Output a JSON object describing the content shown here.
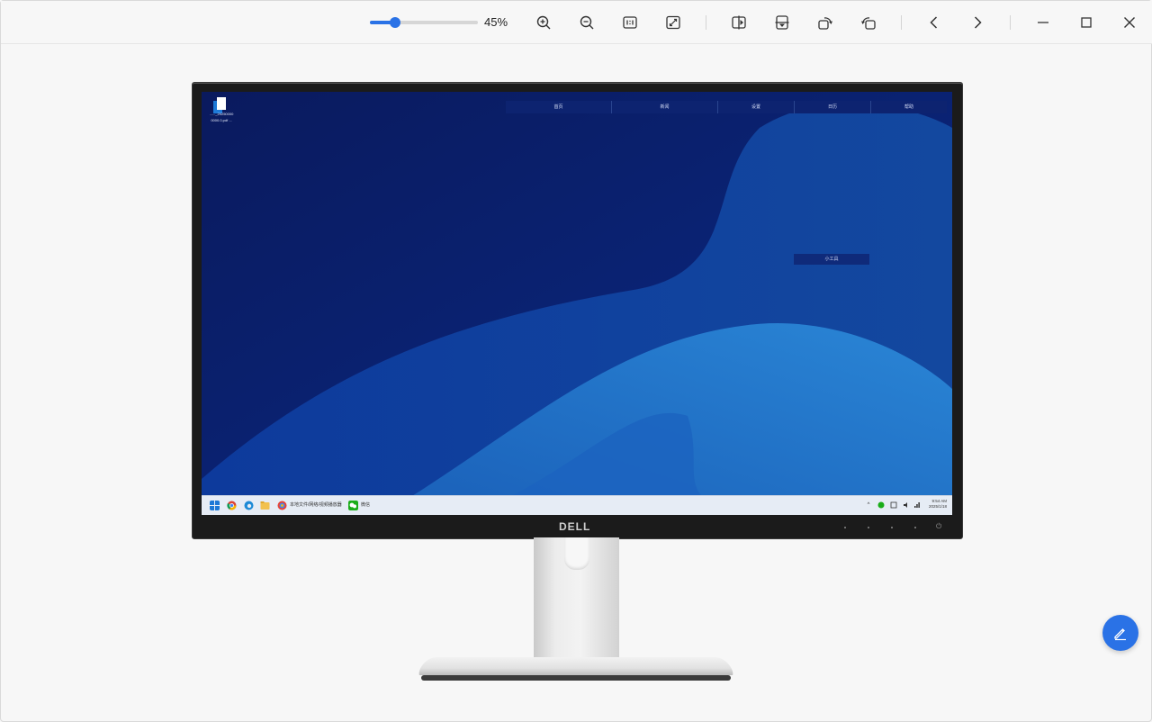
{
  "toolbar": {
    "zoom_percent": 45,
    "zoom_label": "45%",
    "zoom_slider_fraction": 0.23,
    "accent": "#2a72e6",
    "buttons": [
      {
        "name": "zoom-in-icon"
      },
      {
        "name": "zoom-out-icon"
      },
      {
        "name": "actual-size-icon"
      },
      {
        "name": "fit-window-icon"
      },
      {
        "name": "flip-horizontal-icon"
      },
      {
        "name": "flip-vertical-icon"
      },
      {
        "name": "rotate-right-icon"
      },
      {
        "name": "rotate-left-icon"
      },
      {
        "name": "previous-icon"
      },
      {
        "name": "next-icon"
      },
      {
        "name": "minimize-icon"
      },
      {
        "name": "maximize-icon"
      },
      {
        "name": "close-icon"
      }
    ]
  },
  "image": {
    "monitor_brand": "DELL",
    "desktop": {
      "icon_label_line1": "......_20250000",
      "icon_label_line2": "0000.0.pdf ...",
      "top_menu": [
        "首页",
        "新闻",
        "设置",
        "日历",
        "帮助"
      ],
      "floating_label": "小工具",
      "taskbar": {
        "pinned_app_label": "本地文件/网络/视频播放器",
        "second_app_label": "微信",
        "clock_time": "9:54 AM",
        "clock_date": "2025/1/18"
      }
    }
  },
  "fab": {
    "icon": "edit-pencil-icon"
  }
}
